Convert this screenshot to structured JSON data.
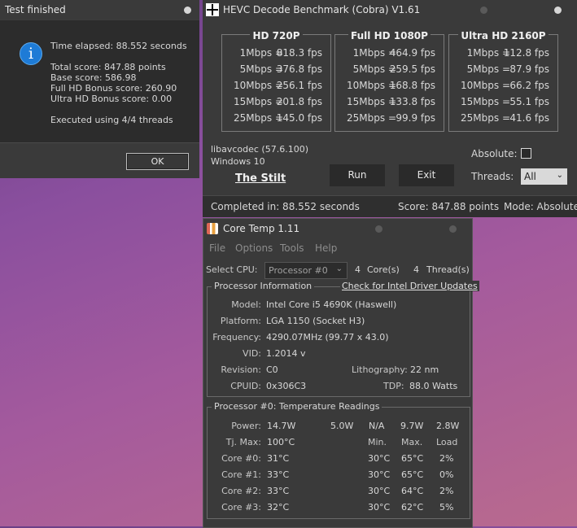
{
  "dialog": {
    "title": "Test finished",
    "icon": "info-icon",
    "icon_glyph": "i",
    "lines": {
      "time_elapsed": "Time elapsed:  88.552 seconds",
      "total_score": "Total score:  847.88 points",
      "base_score": "Base score: 586.98",
      "full_hd_bonus": "Full HD Bonus score: 260.90",
      "ultra_hd_bonus": "Ultra HD Bonus score: 0.00",
      "threads": "Executed using 4/4 threads"
    },
    "ok_label": "OK"
  },
  "benchmark": {
    "title": "HEVC Decode Benchmark (Cobra) V1.61",
    "groups": [
      {
        "title": "HD 720P",
        "rows": [
          {
            "bitrate": "1Mbps =",
            "fps": "818.3 fps"
          },
          {
            "bitrate": "5Mbps =",
            "fps": "376.8 fps"
          },
          {
            "bitrate": "10Mbps =",
            "fps": "256.1 fps"
          },
          {
            "bitrate": "15Mbps =",
            "fps": "201.8 fps"
          },
          {
            "bitrate": "25Mbps =",
            "fps": "145.0 fps"
          }
        ]
      },
      {
        "title": "Full HD 1080P",
        "rows": [
          {
            "bitrate": "1Mbps =",
            "fps": "464.9 fps"
          },
          {
            "bitrate": "5Mbps =",
            "fps": "259.5 fps"
          },
          {
            "bitrate": "10Mbps =",
            "fps": "168.8 fps"
          },
          {
            "bitrate": "15Mbps =",
            "fps": "133.8 fps"
          },
          {
            "bitrate": "25Mbps =",
            "fps": "99.9 fps"
          }
        ]
      },
      {
        "title": "Ultra HD 2160P",
        "rows": [
          {
            "bitrate": "1Mbps =",
            "fps": "112.8 fps"
          },
          {
            "bitrate": "5Mbps =",
            "fps": "87.9 fps"
          },
          {
            "bitrate": "10Mbps =",
            "fps": "66.2 fps"
          },
          {
            "bitrate": "15Mbps =",
            "fps": "55.1 fps"
          },
          {
            "bitrate": "25Mbps =",
            "fps": "41.6 fps"
          }
        ]
      }
    ],
    "libavcodec": "libavcodec (57.6.100)",
    "os": "Windows 10",
    "author_link": "The Stilt",
    "run_label": "Run",
    "exit_label": "Exit",
    "absolute_label": "Absolute:",
    "absolute_checked": false,
    "threads_label": "Threads:",
    "threads_value": "All",
    "status": {
      "completed": "Completed in: 88.552 seconds",
      "score": "Score: 847.88 points",
      "mode": "Mode: Absolute"
    }
  },
  "coretemp": {
    "title": "Core Temp 1.11",
    "menu": [
      "File",
      "Options",
      "Tools",
      "Help"
    ],
    "select_cpu_label": "Select CPU:",
    "select_cpu_value": "Processor #0",
    "cores": "4",
    "cores_label": "Core(s)",
    "threads": "4",
    "threads_label": "Thread(s)",
    "info_caption": "Processor Information",
    "driver_link": "Check for Intel Driver Updates",
    "info": {
      "model_label": "Model:",
      "model": "Intel Core i5 4690K (Haswell)",
      "platform_label": "Platform:",
      "platform": "LGA 1150 (Socket H3)",
      "frequency_label": "Frequency:",
      "frequency": "4290.07MHz (99.77 x 43.0)",
      "vid_label": "VID:",
      "vid": "1.2014 v",
      "revision_label": "Revision:",
      "revision": "C0",
      "lithography_label": "Lithography:",
      "lithography": "22 nm",
      "cpuid_label": "CPUID:",
      "cpuid": "0x306C3",
      "tdp_label": "TDP:",
      "tdp": "88.0 Watts"
    },
    "temps_caption": "Processor #0: Temperature Readings",
    "power_label": "Power:",
    "power": [
      "14.7W",
      "5.0W",
      "N/A",
      "9.7W",
      "2.8W"
    ],
    "tjmax_label": "Tj. Max:",
    "tjmax": "100°C",
    "col_headers": [
      "Min.",
      "Max.",
      "Load"
    ],
    "cores_rows": [
      {
        "label": "Core #0:",
        "temp": "31°C",
        "min": "30°C",
        "max": "65°C",
        "load": "2%"
      },
      {
        "label": "Core #1:",
        "temp": "33°C",
        "min": "30°C",
        "max": "65°C",
        "load": "0%"
      },
      {
        "label": "Core #2:",
        "temp": "33°C",
        "min": "30°C",
        "max": "64°C",
        "load": "2%"
      },
      {
        "label": "Core #3:",
        "temp": "32°C",
        "min": "30°C",
        "max": "62°C",
        "load": "5%"
      }
    ]
  }
}
